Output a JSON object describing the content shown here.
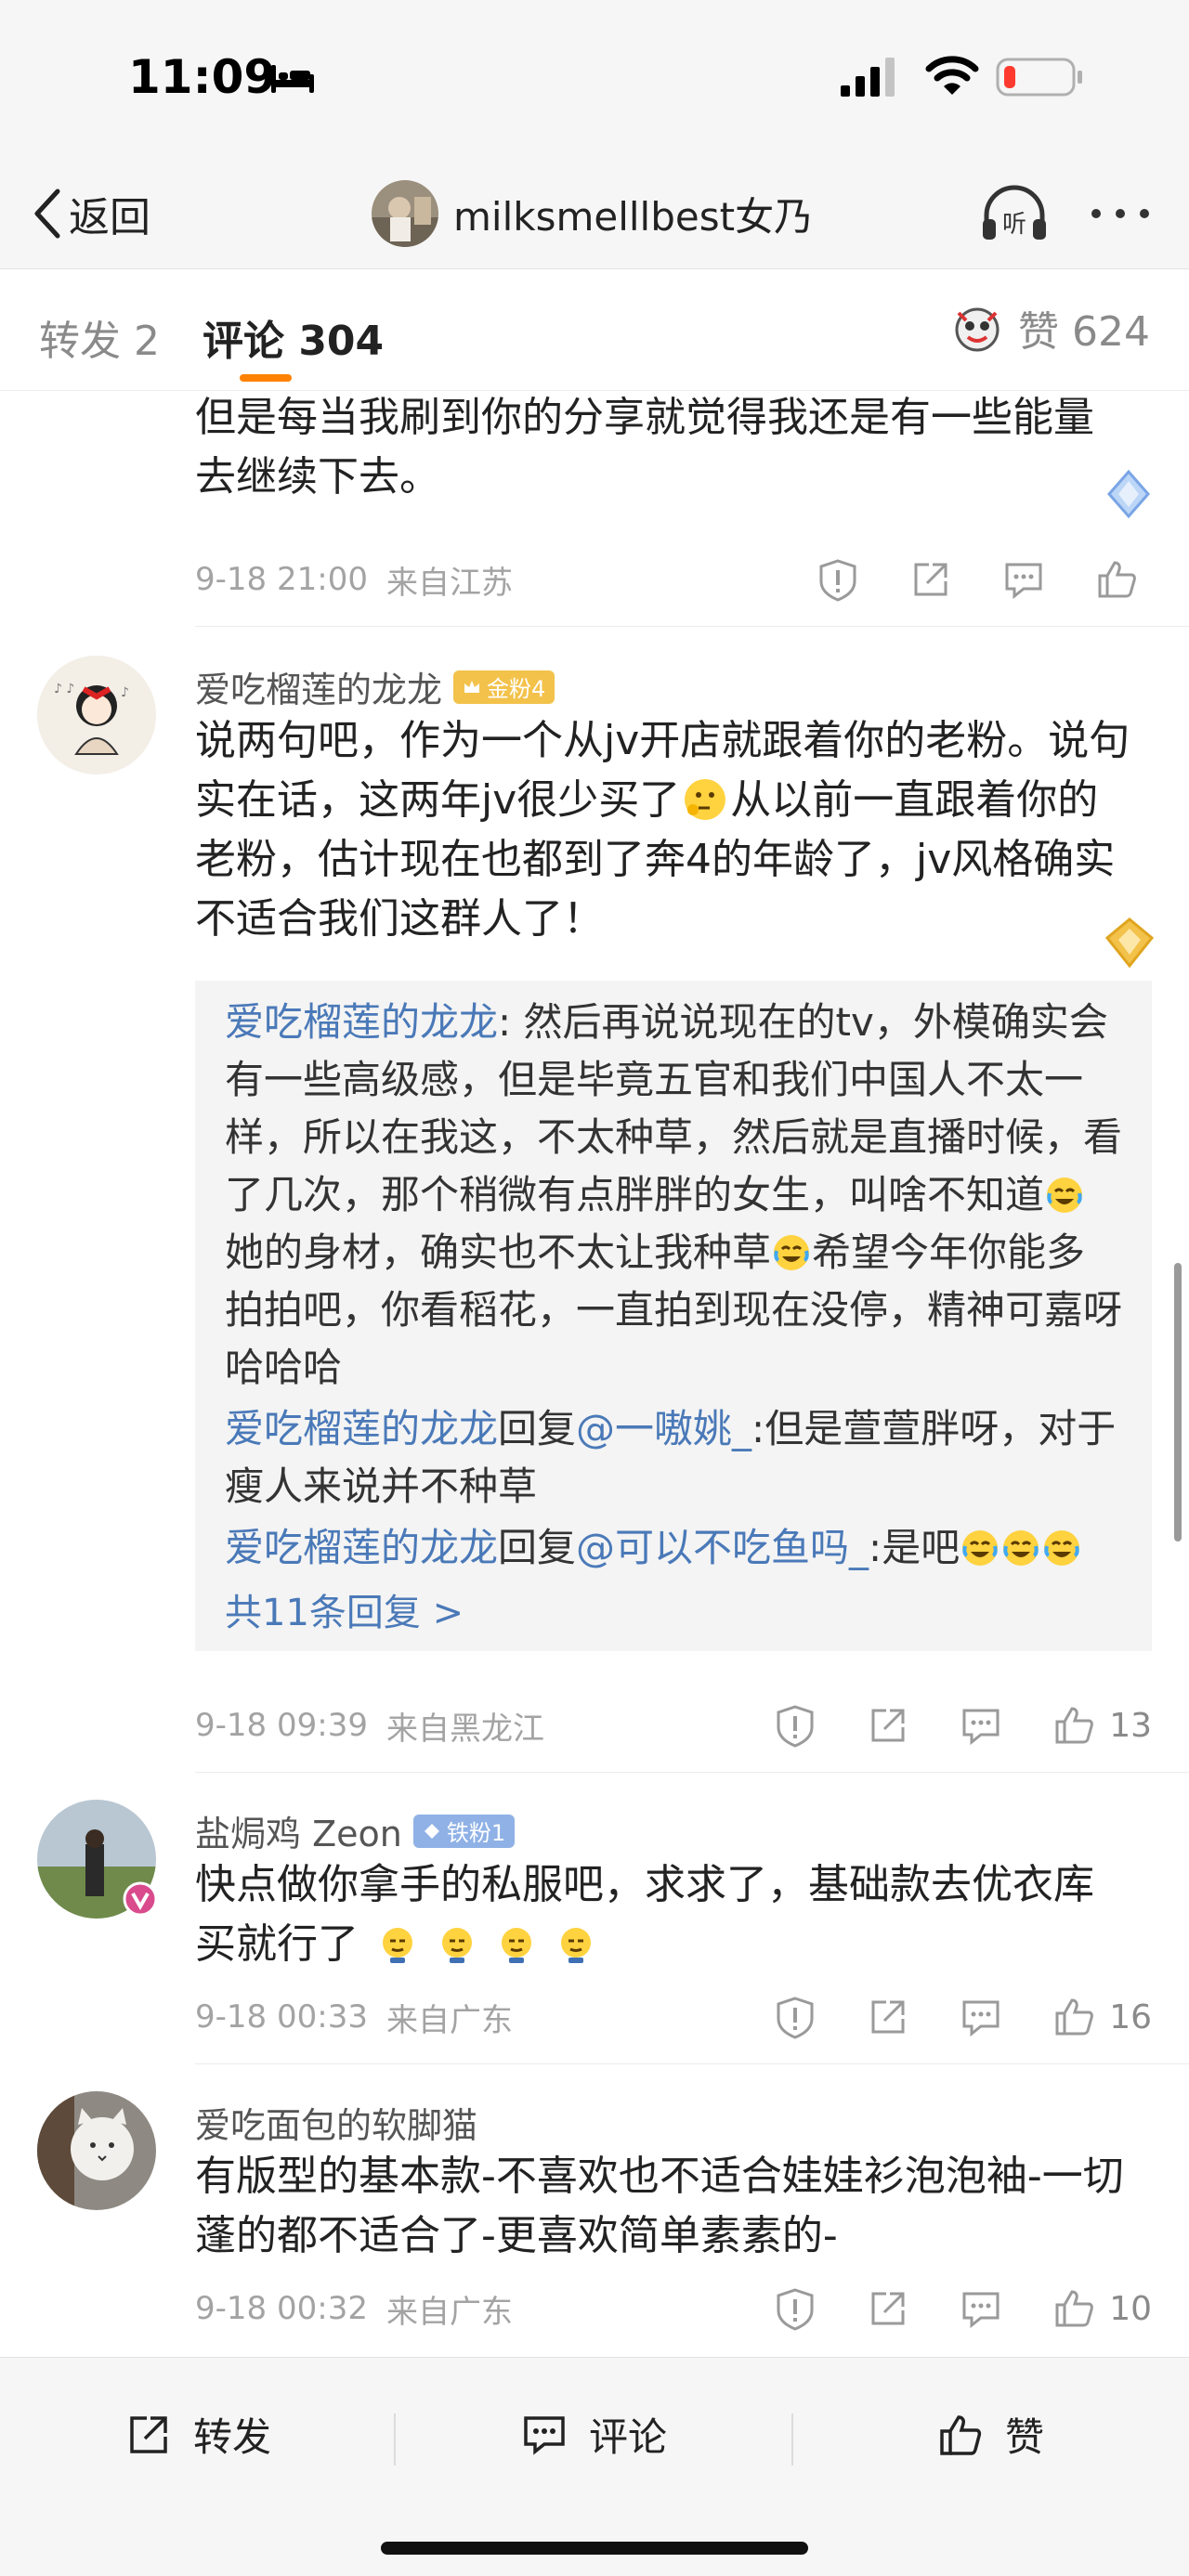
{
  "status_bar": {
    "time": "11:09"
  },
  "nav": {
    "back_label": "返回",
    "title": "milksmelllbest女乃"
  },
  "tabs": {
    "repost": "转发 2",
    "comment": "评论 304",
    "likes": "赞 624"
  },
  "comments": [
    {
      "text": "但是每当我刷到你的分享就觉得我还是有一些能量去继续下去。",
      "time": "9-18 21:00",
      "location": "来自江苏",
      "likes": ""
    },
    {
      "username": "爱吃榴莲的龙龙",
      "badge": "金粉4",
      "text_parts": [
        "说两句吧，作为一个从jv开店就跟着你的老粉。说句实在话，这两年jv很少买了",
        "从以前一直跟着你的老粉，估计现在也都到了奔4的年龄了，jv风格确实不适合我们这群人了！"
      ],
      "replies": [
        {
          "name": "爱吃榴莲的龙龙",
          "parts": [
            ": 然后再说说现在的tv，外模确实会有一些高级感，但是毕竟五官和我们中国人不太一样，所以在我这，不太种草，然后就是直播时候，看了几次，那个稍微有点胖胖的女生，叫啥不知道",
            "她的身材，确实也不太让我种草",
            "希望今年你能多拍拍吧，你看稻花，一直拍到现在没停，精神可嘉呀哈哈哈"
          ]
        },
        {
          "name": "爱吃榴莲的龙龙",
          "mid": "回复",
          "target": "@一嗷姚_",
          "rest": ":但是萱萱胖呀，对于瘦人来说并不种草"
        },
        {
          "name": "爱吃榴莲的龙龙",
          "mid": "回复",
          "target": "@可以不吃鱼吗_",
          "rest": ":是吧"
        }
      ],
      "more_replies": "共11条回复 >",
      "time": "9-18 09:39",
      "location": "来自黑龙江",
      "likes": "13"
    },
    {
      "username": "盐焗鸡 Zeon",
      "badge": "铁粉1",
      "text": "快点做你拿手的私服吧，求求了，基础款去优衣库买就行了",
      "time": "9-18 00:33",
      "location": "来自广东",
      "likes": "16"
    },
    {
      "username": "爱吃面包的软脚猫",
      "text": "有版型的基本款-不喜欢也不适合娃娃衫泡泡袖-一切蓬的都不适合了-更喜欢简单素素的-",
      "time": "9-18 00:32",
      "location": "来自广东",
      "likes": "10"
    }
  ],
  "bottom_bar": {
    "repost": "转发",
    "comment": "评论",
    "like": "赞"
  },
  "colors": {
    "accent": "#ff8200",
    "link": "#4a79b8",
    "gold_badge": "#f3c24b",
    "iron_badge": "#8fb1e6"
  }
}
